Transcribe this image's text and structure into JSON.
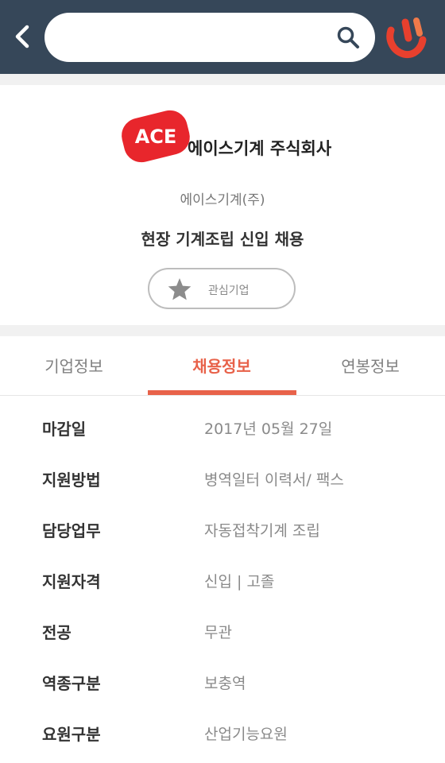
{
  "header": {
    "search_value": "",
    "search_placeholder": ""
  },
  "company": {
    "logo_badge": "ACE",
    "logo_text": "에이스기계 주식회사",
    "name": "에이스기계(주)",
    "job_title": "현장 기계조립 신입 채용",
    "favorite_label": "관심기업"
  },
  "tabs": [
    {
      "label": "기업정보",
      "active": false
    },
    {
      "label": "채용정보",
      "active": true
    },
    {
      "label": "연봉정보",
      "active": false
    }
  ],
  "details": [
    {
      "label": "마감일",
      "value": "2017년 05월 27일"
    },
    {
      "label": "지원방법",
      "value": "병역일터 이력서/ 팩스"
    },
    {
      "label": "담당업무",
      "value": "자동접착기계 조립"
    },
    {
      "label": "지원자격",
      "value": "신입 | 고졸"
    },
    {
      "label": "전공",
      "value": "무관"
    },
    {
      "label": "역종구분",
      "value": "보충역"
    },
    {
      "label": "요원구분",
      "value": "산업기능요원"
    }
  ],
  "colors": {
    "header_bg": "#364759",
    "accent": "#e8624a",
    "ace_red": "#e8262c",
    "brand_red": "#e8402e"
  },
  "icons": {
    "back": "chevron-left-icon",
    "search": "search-icon",
    "brand": "app-logo-icon",
    "favorite": "star-icon"
  }
}
